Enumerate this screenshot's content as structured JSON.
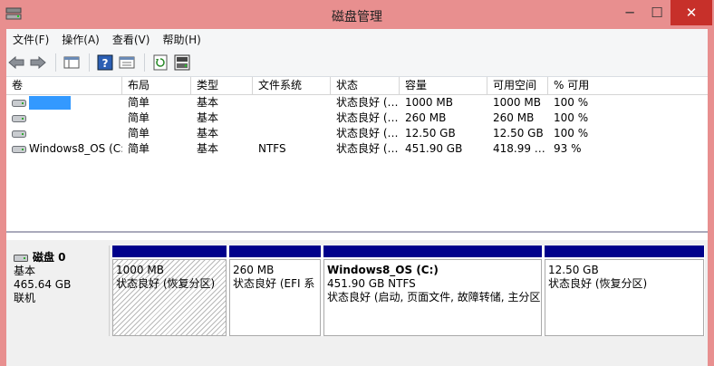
{
  "window": {
    "title": "磁盘管理"
  },
  "menu": [
    "文件(F)",
    "操作(A)",
    "查看(V)",
    "帮助(H)"
  ],
  "columns": [
    "卷",
    "布局",
    "类型",
    "文件系统",
    "状态",
    "容量",
    "可用空间",
    "% 可用"
  ],
  "volumes": [
    {
      "name": "",
      "layout": "简单",
      "type": "基本",
      "fs": "",
      "status": "状态良好 (…",
      "capacity": "1000 MB",
      "free": "1000 MB",
      "pct": "100 %",
      "selected": true
    },
    {
      "name": "",
      "layout": "简单",
      "type": "基本",
      "fs": "",
      "status": "状态良好 (…",
      "capacity": "260 MB",
      "free": "260 MB",
      "pct": "100 %"
    },
    {
      "name": "",
      "layout": "简单",
      "type": "基本",
      "fs": "",
      "status": "状态良好 (…",
      "capacity": "12.50 GB",
      "free": "12.50 GB",
      "pct": "100 %"
    },
    {
      "name": "Windows8_OS (C:)",
      "layout": "简单",
      "type": "基本",
      "fs": "NTFS",
      "status": "状态良好 (…",
      "capacity": "451.90 GB",
      "free": "418.99 …",
      "pct": "93 %"
    }
  ],
  "disk": {
    "name": "磁盘 0",
    "type": "基本",
    "size": "465.64 GB",
    "state": "联机"
  },
  "partitions": [
    {
      "title": "",
      "size": "1000 MB",
      "status": "状态良好 (恢复分区)"
    },
    {
      "title": "",
      "size": "260 MB",
      "status": "状态良好 (EFI 系"
    },
    {
      "title": "Windows8_OS  (C:)",
      "size": "451.90 GB NTFS",
      "status": "状态良好 (启动, 页面文件, 故障转储, 主分区"
    },
    {
      "title": "",
      "size": "12.50 GB",
      "status": "状态良好 (恢复分区)"
    }
  ],
  "colors": {
    "window_frame": "#e88f8f",
    "close_button": "#c7302a",
    "partition_bar": "#00008b",
    "selection": "#3399ff"
  }
}
